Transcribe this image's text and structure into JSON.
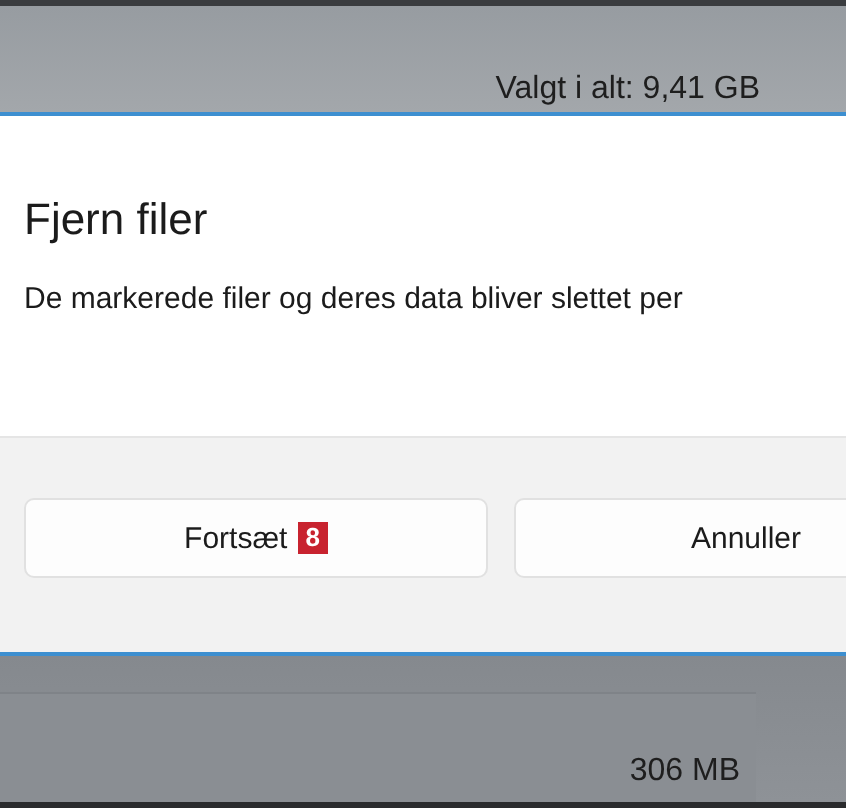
{
  "summary": {
    "text": "Valgt i alt: 9,41 GB"
  },
  "dialog": {
    "title": "Fjern filer",
    "message": "De markerede filer og deres data bliver slettet per",
    "buttons": [
      {
        "label": "Fortsæt",
        "badge": "8"
      },
      {
        "label": "Annuller"
      }
    ]
  },
  "list_item": {
    "size": "306 MB"
  }
}
